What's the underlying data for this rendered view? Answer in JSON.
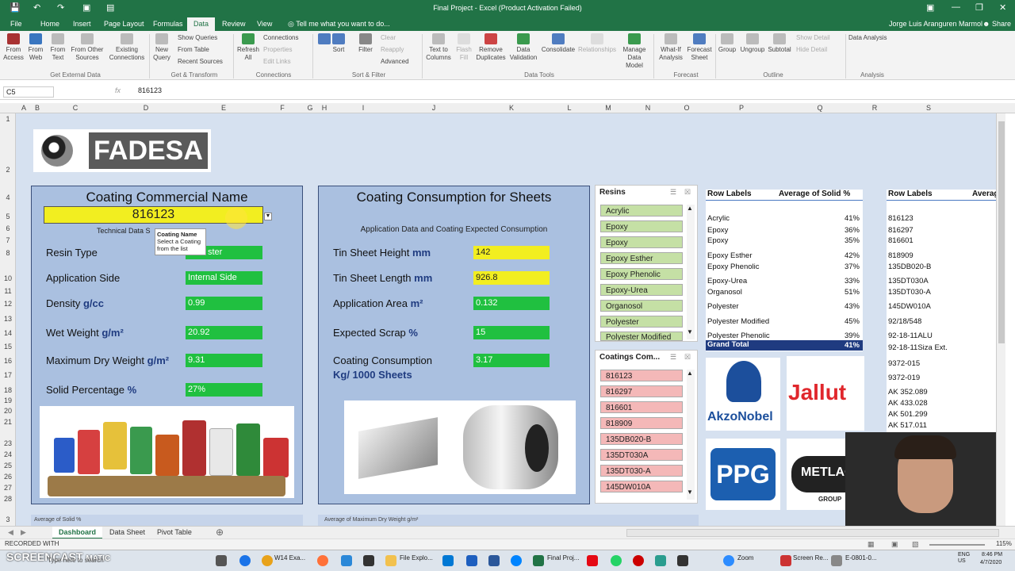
{
  "window": {
    "title": "Final Project - Excel (Product Activation Failed)",
    "user": "Jorge Luis Aranguren Marmol",
    "share": "Share"
  },
  "menu": {
    "tabs": [
      "File",
      "Home",
      "Insert",
      "Page Layout",
      "Formulas",
      "Data",
      "Review",
      "View"
    ],
    "tell_me": "Tell me what you want to do..."
  },
  "ribbon": {
    "get_external": {
      "items": [
        "From Access",
        "From Web",
        "From Text",
        "From Other Sources",
        "Existing Connections"
      ],
      "group": "Get External Data"
    },
    "get_transform": {
      "new_query": "New Query",
      "show_queries": "Show Queries",
      "from_table": "From Table",
      "recent_sources": "Recent Sources",
      "group": "Get & Transform"
    },
    "connections": {
      "refresh": "Refresh All",
      "connections": "Connections",
      "properties": "Properties",
      "edit_links": "Edit Links",
      "group": "Connections"
    },
    "sort_filter": {
      "sort": "Sort",
      "filter": "Filter",
      "clear": "Clear",
      "reapply": "Reapply",
      "advanced": "Advanced",
      "group": "Sort & Filter"
    },
    "data_tools": {
      "text_to_columns": "Text to Columns",
      "flash_fill": "Flash Fill",
      "remove_duplicates": "Remove Duplicates",
      "data_validation": "Data Validation",
      "consolidate": "Consolidate",
      "relationships": "Relationships",
      "manage_model": "Manage Data Model",
      "group": "Data Tools"
    },
    "forecast": {
      "what_if": "What-If Analysis",
      "forecast_sheet": "Forecast Sheet",
      "group": "Forecast"
    },
    "outline": {
      "group_btn": "Group",
      "ungroup": "Ungroup",
      "subtotal": "Subtotal",
      "show_detail": "Show Detail",
      "hide_detail": "Hide Detail",
      "group": "Outline"
    },
    "analysis": {
      "data_analysis": "Data Analysis",
      "group": "Analysis"
    }
  },
  "formula_bar": {
    "cell_ref": "C5",
    "value": "816123",
    "fx": "fx"
  },
  "columns": [
    "A",
    "B",
    "C",
    "D",
    "E",
    "F",
    "G",
    "H",
    "I",
    "J",
    "K",
    "L",
    "M",
    "N",
    "O",
    "P",
    "Q",
    "R",
    "S"
  ],
  "rows": [
    "1",
    "2",
    "4",
    "5",
    "6",
    "7",
    "8",
    "10",
    "11",
    "12",
    "13",
    "14",
    "15",
    "16",
    "17",
    "18",
    "19",
    "20",
    "21",
    "23",
    "24",
    "25",
    "26",
    "27",
    "28",
    "3"
  ],
  "brand": "FADESA",
  "coating_panel": {
    "title": "Coating Commercial Name",
    "selected": "816123",
    "subtitle": "Technical Data S",
    "tooltip_title": "Coating Name",
    "tooltip_body": "Select a Coating from the list",
    "fields": [
      {
        "label": "Resin Type",
        "unit": "",
        "value": "ster"
      },
      {
        "label": "Application Side",
        "unit": "",
        "value": "Internal Side"
      },
      {
        "label": "Density",
        "unit": "g/cc",
        "value": "0.99"
      },
      {
        "label": "Wet Weight",
        "unit": "g/m²",
        "value": "20.92"
      },
      {
        "label": "Maximum Dry Weight",
        "unit": "g/m²",
        "value": "9.31"
      },
      {
        "label": "Solid Percentage",
        "unit": "%",
        "value": "27%"
      }
    ]
  },
  "consumption_panel": {
    "title": "Coating Consumption for Sheets",
    "subtitle": "Application Data and Coating Expected Consumption",
    "fields": [
      {
        "label": "Tin Sheet Height",
        "unit": "mm",
        "value": "142",
        "color": "yellow"
      },
      {
        "label": "Tin Sheet Length",
        "unit": "mm",
        "value": "926.8",
        "color": "yellow"
      },
      {
        "label": "Application Area",
        "unit": "m²",
        "value": "0.132",
        "color": "green"
      },
      {
        "label": "Expected Scrap",
        "unit": "%",
        "value": "15",
        "color": "yellow"
      },
      {
        "label": "Coating Consumption",
        "unit": "",
        "value": "3.17",
        "color": "green"
      }
    ],
    "unit_line": "Kg/ 1000 Sheets"
  },
  "resins_slicer": {
    "title": "Resins",
    "items": [
      "Acrylic",
      "Epoxy",
      "Epoxy",
      "Epoxy Esther",
      "Epoxy Phenolic",
      "Epoxy-Urea",
      "Organosol",
      "Polyester",
      "Polyester Modified"
    ]
  },
  "coatings_slicer": {
    "title": "Coatings Com...",
    "items": [
      "816123",
      "816297",
      "816601",
      "818909",
      "135DB020-B",
      "135DT030A",
      "135DT030-A",
      "145DW010A"
    ]
  },
  "pivot1": {
    "col1": "Row Labels",
    "col2": "Average of Solid %",
    "rows": [
      {
        "label": "Acrylic",
        "value": "41%"
      },
      {
        "label": "Epoxy",
        "value": "36%"
      },
      {
        "label": "Epoxy",
        "value": "35%"
      },
      {
        "label": "Epoxy Esther",
        "value": "42%"
      },
      {
        "label": "Epoxy Phenolic",
        "value": "37%"
      },
      {
        "label": "Epoxy-Urea",
        "value": "33%"
      },
      {
        "label": "Organosol",
        "value": "51%"
      },
      {
        "label": "Polyester",
        "value": "43%"
      },
      {
        "label": "Polyester Modified",
        "value": "45%"
      },
      {
        "label": "Polyester Phenolic",
        "value": "39%"
      }
    ],
    "total_label": "Grand Total",
    "total_value": "41%"
  },
  "pivot2": {
    "col1": "Row Labels",
    "col2": "Average",
    "rows": [
      "816123",
      "816297",
      "816601",
      "818909",
      "135DB020-B",
      "135DT030A",
      "135DT030-A",
      "145DW010A",
      "92/18/548",
      "92-18-11ALU",
      "92-18-11Siza Ext.",
      "9372-015",
      "9372-019",
      "AK 352.089",
      "AK 433.028",
      "AK 501.299",
      "AK 517.011"
    ]
  },
  "logos": {
    "akzo": "AkzoNobel",
    "jallut": "Jallut",
    "ppg": "PPG",
    "metlac": "METLAC",
    "metlac_sub": "GROUP"
  },
  "below_labels": {
    "left": "Average of Solid %",
    "mid": "Average of Maximum Dry Weight g/m²"
  },
  "sheet_tabs": [
    "Dashboard",
    "Data Sheet",
    "Pivot Table"
  ],
  "status": {
    "zoom": "115%"
  },
  "taskbar": {
    "search": "Type here to search",
    "items": [
      "W14 Exa...",
      "File Explo...",
      "Final Proj...",
      "Zoom",
      "Screen Re...",
      "E-0801-0..."
    ],
    "lang": "ENG\nUS",
    "time": "8:46 PM",
    "date": "4/7/2020"
  },
  "watermark": {
    "line1": "RECORDED WITH",
    "line2": "SCREENCAST",
    "line3": "MATIC"
  },
  "colors": {
    "excel_green": "#217346",
    "panel_blue": "#aac0e0",
    "field_green": "#20c040",
    "field_yellow": "#f2ee20"
  }
}
